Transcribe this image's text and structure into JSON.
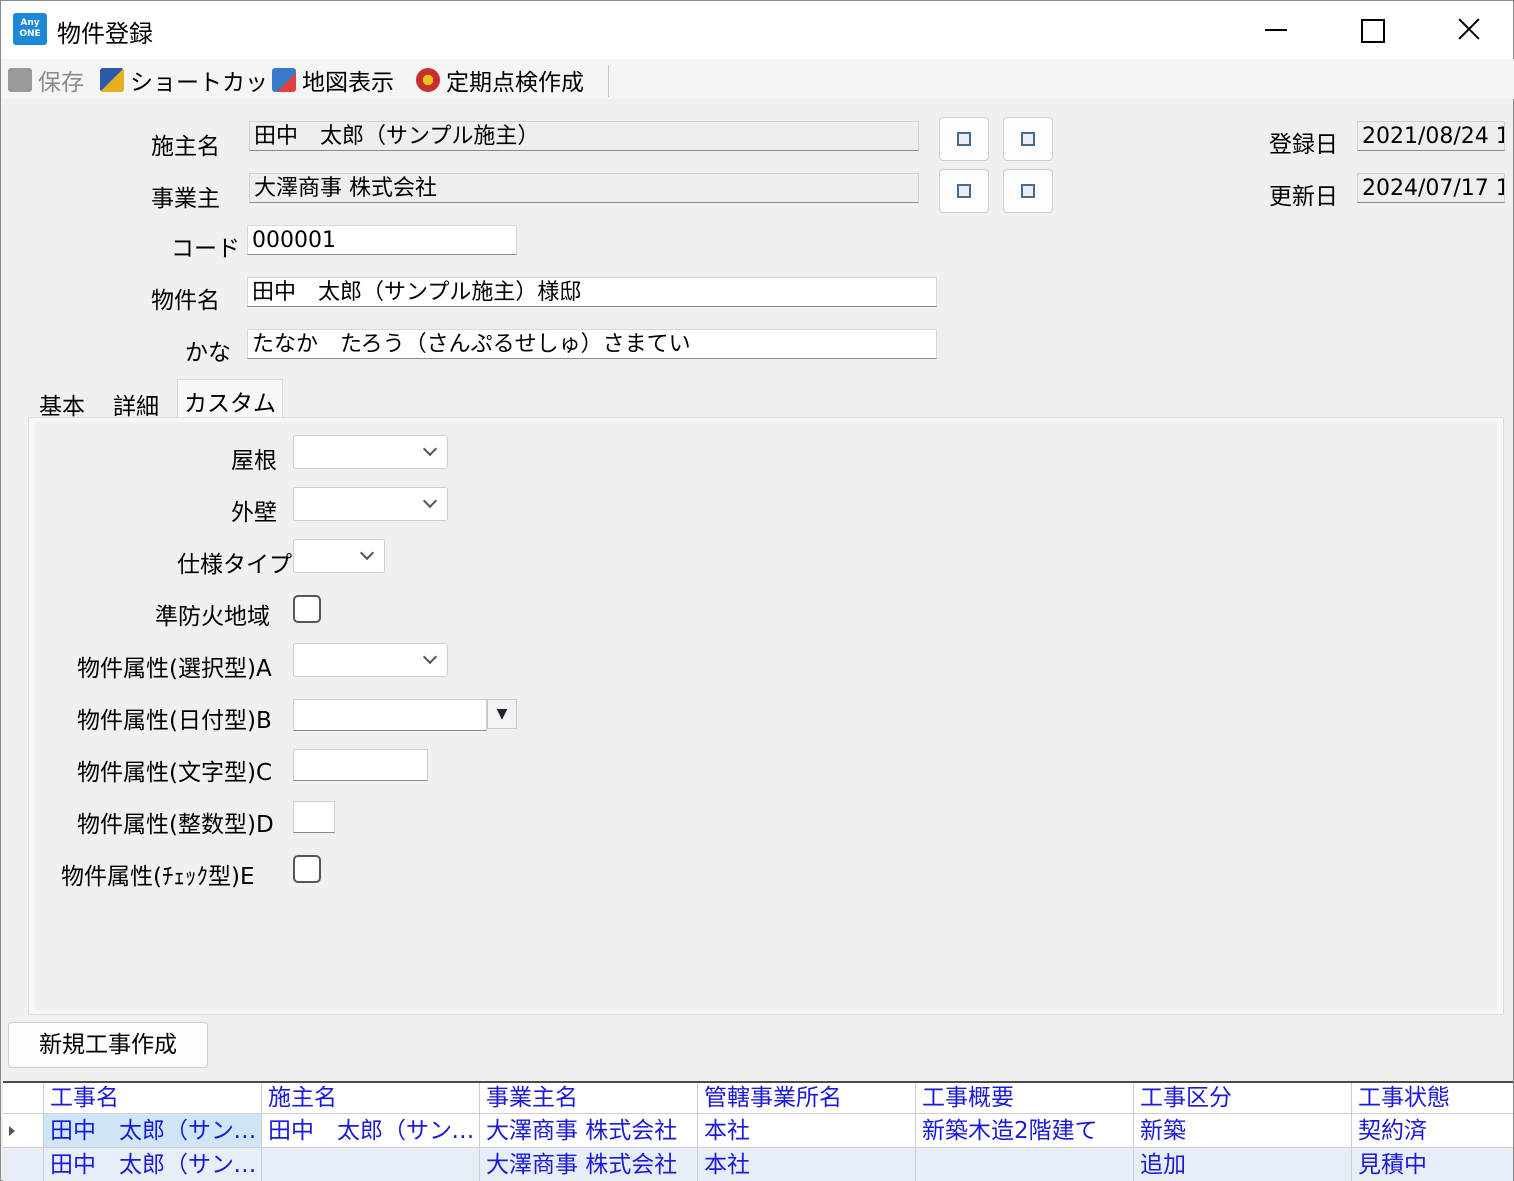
{
  "window": {
    "title": "物件登録",
    "logo_text_top": "Any",
    "logo_text_bottom": "ONE"
  },
  "toolbar": {
    "save": "保存",
    "shortcut": "ショートカット",
    "map": "地図表示",
    "inspection": "定期点検作成"
  },
  "form": {
    "owner_label": "施主名",
    "owner_value": "田中　太郎（サンプル施主）",
    "business_label": "事業主",
    "business_value": "大澤商事 株式会社",
    "code_label": "コード",
    "code_value": "000001",
    "property_label": "物件名",
    "property_value": "田中　太郎（サンプル施主）様邸",
    "kana_label": "かな",
    "kana_value": "たなか　たろう（さんぷるせしゅ）さまてい",
    "registered_label": "登録日",
    "registered_value": "2021/08/24 1",
    "updated_label": "更新日",
    "updated_value": "2024/07/17 1"
  },
  "tabs": [
    {
      "label": "基本"
    },
    {
      "label": "詳細"
    },
    {
      "label": "カスタム"
    }
  ],
  "custom": {
    "roof": "屋根",
    "wall": "外壁",
    "spec_type": "仕様タイプ",
    "fire_zone": "準防火地域",
    "attr_a": "物件属性(選択型)A",
    "attr_b": "物件属性(日付型)B",
    "attr_c": "物件属性(文字型)C",
    "attr_d": "物件属性(整数型)D",
    "attr_e": "物件属性(ﾁｪｯｸ型)E",
    "date_drop_glyph": "▼"
  },
  "new_work_button": "新規工事作成",
  "grid": {
    "columns": [
      "工事名",
      "施主名",
      "事業主名",
      "管轄事業所名",
      "工事概要",
      "工事区分",
      "工事状態"
    ],
    "rows": [
      [
        "田中　太郎（サンプル施主）",
        "田中　太郎（サンプル施主）",
        "大澤商事 株式会社",
        "本社",
        "新築木造2階建て",
        "新築",
        "契約済"
      ],
      [
        "田中　太郎（サンプル施主）",
        "",
        "大澤商事 株式会社",
        "本社",
        "",
        "追加",
        "見積中"
      ]
    ]
  }
}
